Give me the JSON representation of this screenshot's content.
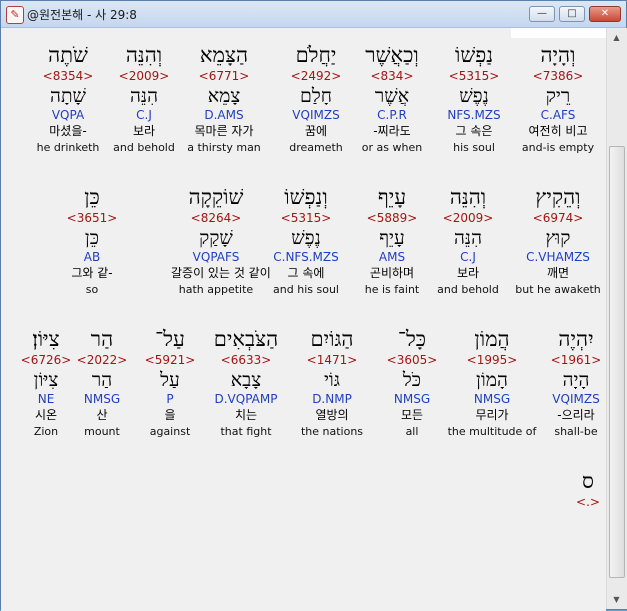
{
  "window": {
    "title": "@원전본해 - 사 29:8",
    "app_icon": "book-icon",
    "min_glyph": "—",
    "max_glyph": "□",
    "close_glyph": "✕"
  },
  "rows": [
    {
      "words": [
        {
          "heb": "וְהָיָה",
          "strong": "<7386>",
          "lemma": "רֵיק",
          "parse": "C.AFS",
          "kor": "여전히 비고",
          "eng": "and-is empty"
        },
        {
          "heb": "נַפְשׁוֹ",
          "strong": "<5315>",
          "lemma": "נֶפֶשׁ",
          "parse": "NFS.MZS",
          "kor": "그 속은",
          "eng": "his soul"
        },
        {
          "heb": "וְכַאֲשֶׁר",
          "strong": "<834>",
          "lemma": "אֲשֶׁר",
          "parse": "C.P.R",
          "kor": "-찌라도",
          "eng": "or as when"
        },
        {
          "heb": "יַחֲלֹם",
          "strong": "<2492>",
          "lemma": "חָלַם",
          "parse": "VQIMZS",
          "kor": "꿈에",
          "eng": "dreameth"
        },
        {
          "heb": "הַצָּמֵא",
          "strong": "<6771>",
          "lemma": "צָמֵא",
          "parse": "D.AMS",
          "kor": "목마른 자가",
          "eng": "a thirsty man"
        },
        {
          "heb": "וְהִנֵּה",
          "strong": "<2009>",
          "lemma": "הִנֵּה",
          "parse": "C.J",
          "kor": "보라",
          "eng": "and behold"
        },
        {
          "heb": "שֹׁתֶה",
          "strong": "<8354>",
          "lemma": "שָׁתָה",
          "parse": "VQPA",
          "kor": "마셨을-",
          "eng": "he drinketh"
        }
      ]
    },
    {
      "words": [
        {
          "heb": "וְהֵקִיץ",
          "strong": "<6974>",
          "lemma": "קוּץ",
          "parse": "C.VHAMZS",
          "kor": "깨면",
          "eng": "but he awaketh"
        },
        {
          "heb": "וְהִנֵּה",
          "strong": "<2009>",
          "lemma": "הִנֵּה",
          "parse": "C.J",
          "kor": "보라",
          "eng": "and behold"
        },
        {
          "heb": "עָיֵף",
          "strong": "<5889>",
          "lemma": "עָיֵף",
          "parse": "AMS",
          "kor": "곤비하며",
          "eng": "he is faint"
        },
        {
          "heb": "וְנַפְשׁוֹ",
          "strong": "<5315>",
          "lemma": "נֶפֶשׁ",
          "parse": "C.NFS.MZS",
          "kor": "그 속에",
          "eng": "and his soul"
        },
        {
          "heb": "שׁוֹקֵקָה",
          "strong": "<8264>",
          "lemma": "שָׁקַק",
          "parse": "VQPAFS",
          "kor": "갈증이 있는 것 같이",
          "eng": "hath appetite"
        },
        {
          "heb": "כֵּן",
          "strong": "<3651>",
          "lemma": "כֵּן",
          "parse": "AB",
          "kor": "그와 같-",
          "eng": "so"
        }
      ]
    },
    {
      "words": [
        {
          "heb": "יִהְיֶה",
          "strong": "<1961>",
          "lemma": "הָיָה",
          "parse": "VQIMZS",
          "kor": "-으리라",
          "eng": "shall-be"
        },
        {
          "heb": "הֲמוֹן",
          "strong": "<1995>",
          "lemma": "הָמוֹן",
          "parse": "NMSG",
          "kor": "무리가",
          "eng": "the multitude of"
        },
        {
          "heb": "כָּל־",
          "strong": "<3605>",
          "lemma": "כֹּל",
          "parse": "NMSG",
          "kor": "모든",
          "eng": "all"
        },
        {
          "heb": "הַגּוֹיִם",
          "strong": "<1471>",
          "lemma": "גּוֹי",
          "parse": "D.NMP",
          "kor": "열방의",
          "eng": "the nations"
        },
        {
          "heb": "הַצֹּבְאִים",
          "strong": "<6633>",
          "lemma": "צָבָא",
          "parse": "D.VQPAMP",
          "kor": "치는",
          "eng": "that fight"
        },
        {
          "heb": "עַל־",
          "strong": "<5921>",
          "lemma": "עַל",
          "parse": "P",
          "kor": "을",
          "eng": "against"
        },
        {
          "heb": "הַר",
          "strong": "<2022>",
          "lemma": "הַר",
          "parse": "NMSG",
          "kor": "산",
          "eng": "mount"
        },
        {
          "heb": "צִיּוֹן׃",
          "strong": "<6726>",
          "lemma": "צִיּוֹן",
          "parse": "NE",
          "kor": "시온",
          "eng": "Zion"
        }
      ]
    },
    {
      "words": [
        {
          "heb": "ס",
          "strong": "<.>"
        }
      ]
    }
  ]
}
